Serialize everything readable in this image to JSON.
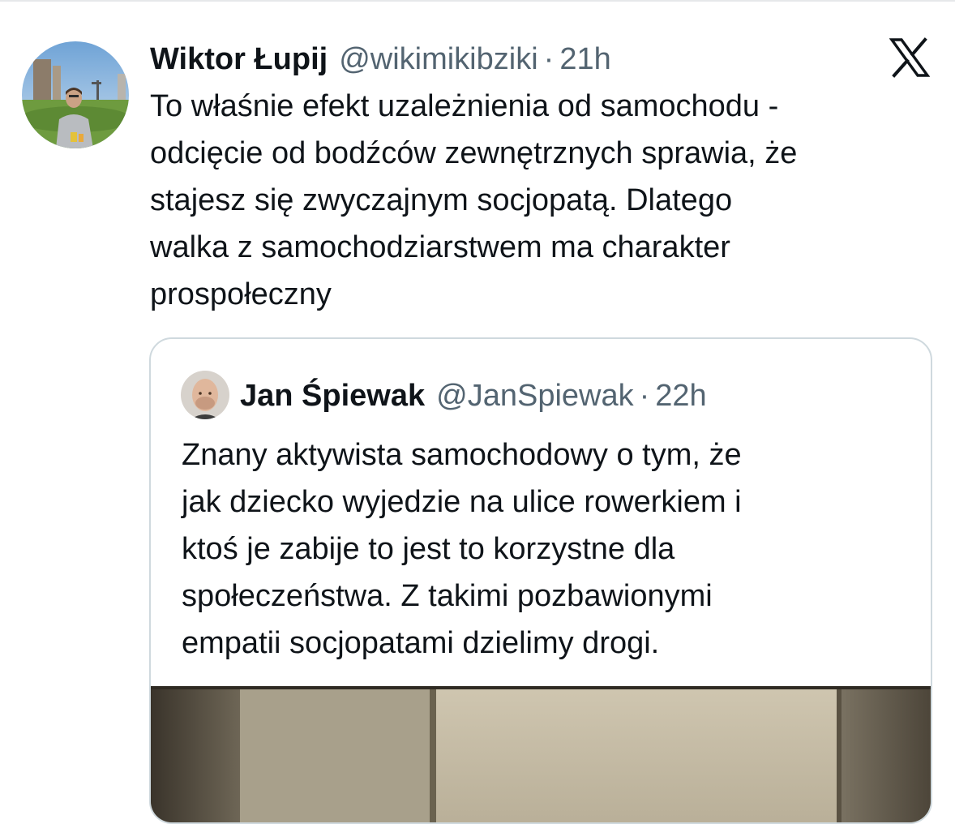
{
  "brand": {
    "logo_icon": "x-logo-icon",
    "text_color": "#0f1419",
    "muted_color": "#536471",
    "border_color": "#cfd9de"
  },
  "tweet": {
    "author_name": "Wiktor Łupij",
    "author_handle": "@wikimikibziki",
    "separator": "·",
    "time": "21h",
    "text_lines": [
      "To właśnie efekt uzależnienia od samochodu -",
      "odcięcie od bodźców zewnętrznych sprawia, że",
      "stajesz się zwyczajnym socjopatą. Dlatego",
      "walka z samochodziarstwem ma charakter",
      "prospołeczny"
    ]
  },
  "quoted_tweet": {
    "author_name": "Jan Śpiewak",
    "author_handle": "@JanSpiewak",
    "separator": "·",
    "time": "22h",
    "text_lines": [
      "Znany aktywista samochodowy o tym, że",
      "jak dziecko wyjedzie na ulice rowerkiem i",
      "ktoś je zabije to jest to korzystne dla",
      "społeczeństwa. Z takimi pozbawionymi",
      "empatii socjopatami dzielimy drogi."
    ]
  }
}
